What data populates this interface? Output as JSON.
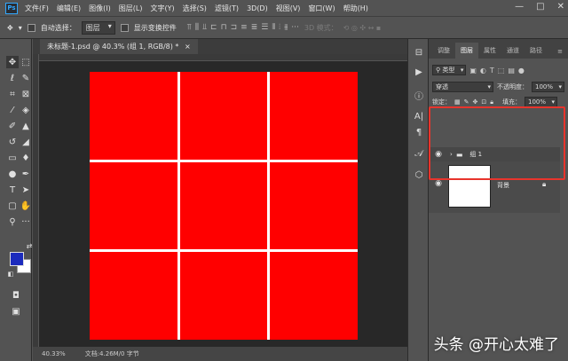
{
  "menubar": {
    "items": [
      "文件(F)",
      "编辑(E)",
      "图像(I)",
      "图层(L)",
      "文字(Y)",
      "选择(S)",
      "滤镜(T)",
      "3D(D)",
      "视图(V)",
      "窗口(W)",
      "帮助(H)"
    ],
    "app_logo": "Ps",
    "minimize": "—",
    "maximize": "□",
    "close": "✕"
  },
  "options": {
    "auto_select_label": "自动选择：",
    "auto_select_value": "图层",
    "show_transform_label": "显示变换控件",
    "mode_3d_label": "3D 模式："
  },
  "document": {
    "tab_title": "未标题-1.psd @ 40.3% (组 1, RGB/8) *",
    "canvas_color": "#ff0000"
  },
  "status": {
    "zoom": "40.33%",
    "doc_size": "文档:4.26M/0 字节"
  },
  "colors": {
    "foreground": "#1c2bbd",
    "background": "#ffffff"
  },
  "layers_panel": {
    "tabs": [
      "调整",
      "图层",
      "属性",
      "通道",
      "路径"
    ],
    "active_tab": "图层",
    "filter_kind": "类型",
    "blend_mode": "穿透",
    "opacity_label": "不透明度：",
    "opacity_value": "100%",
    "lock_label": "锁定：",
    "fill_label": "填充：",
    "fill_value": "100%",
    "layers": [
      {
        "name": "组 1",
        "kind": "group"
      },
      {
        "name": "背景",
        "kind": "background"
      }
    ]
  },
  "watermark": "头条 @开心太难了"
}
